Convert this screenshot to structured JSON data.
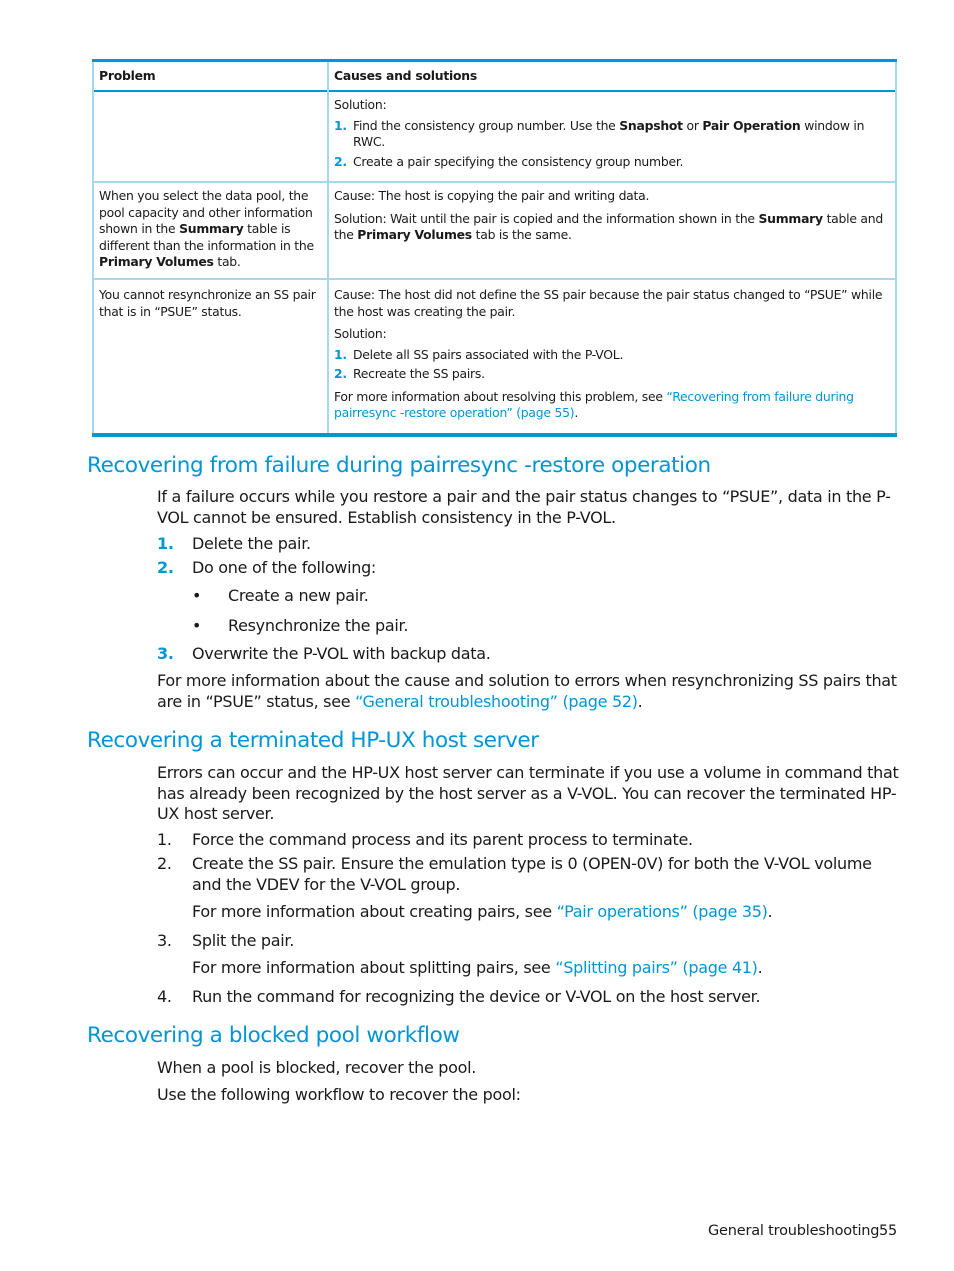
{
  "table": {
    "headers": [
      "Problem",
      "Causes and solutions"
    ],
    "rows": [
      {
        "problem": "",
        "solution_label": "Solution:",
        "steps": [
          {
            "num": "1.",
            "pre": "Find the consistency group number. Use the ",
            "b1": "Snapshot",
            "mid": " or ",
            "b2": "Pair Operation",
            "post": " window in RWC."
          },
          {
            "num": "2.",
            "text": "Create a pair specifying the consistency group number."
          }
        ]
      },
      {
        "problem": {
          "pre": "When you select the data pool, the pool capacity and other information shown in the ",
          "b1": "Summary",
          "mid": " table is different than the information in the ",
          "b2": "Primary Volumes",
          "post": " tab."
        },
        "cause": "Cause: The host is copying the pair and writing data.",
        "solution": {
          "pre": "Solution: Wait until the pair is copied and the information shown in the ",
          "b1": "Summary",
          "mid": " table and the ",
          "b2": "Primary Volumes",
          "post": " tab is the same."
        }
      },
      {
        "problem": "You cannot resynchronize an SS pair that is in “PSUE” status.",
        "cause": "Cause: The host did not define the SS pair because the pair status changed to “PSUE” while the host was creating the pair.",
        "solution_label": "Solution:",
        "steps": [
          {
            "num": "1.",
            "text": "Delete all SS pairs associated with the P-VOL."
          },
          {
            "num": "2.",
            "text": "Recreate the SS pairs."
          }
        ],
        "more_pre": "For more information about resolving this problem, see ",
        "more_link": "“Recovering from failure during pairresync -restore operation” (page 55)",
        "more_post": "."
      }
    ]
  },
  "section1": {
    "title": "Recovering from failure during pairresync -restore operation",
    "intro": "If a failure occurs while you restore a pair and the pair status changes to “PSUE”, data in the P-VOL cannot be ensured. Establish consistency in the P-VOL.",
    "steps": [
      {
        "num": "1.",
        "text": "Delete the pair."
      },
      {
        "num": "2.",
        "text": "Do one of the following:"
      },
      {
        "num": "3.",
        "text": "Overwrite the P-VOL with backup data."
      }
    ],
    "bullets": [
      "Create a new pair.",
      "Resynchronize the pair."
    ],
    "bullet_glyph": "•",
    "more_pre": "For more information about the cause and solution to errors when resynchronizing SS pairs that are in “PSUE” status, see ",
    "more_link": "“General troubleshooting” (page 52)",
    "more_post": "."
  },
  "section2": {
    "title": "Recovering a terminated HP-UX host server",
    "intro": "Errors can occur and the HP-UX host server can terminate if you use a volume in command that has already been recognized by the host server as a V-VOL. You can recover the terminated HP-UX host server.",
    "steps": [
      {
        "num": "1.",
        "text": "Force the command process and its parent process to terminate."
      },
      {
        "num": "2.",
        "text": "Create the SS pair. Ensure the emulation type is 0 (OPEN-0V) for both the V-VOL volume and the VDEV for the V-VOL group."
      },
      {
        "num": "3.",
        "text": "Split the pair."
      },
      {
        "num": "4.",
        "text": "Run the command for recognizing the device or V-VOL on the host server."
      }
    ],
    "note2_pre": "For more information about creating pairs, see ",
    "note2_link": "“Pair operations” (page 35)",
    "note3_pre": "For more information about splitting pairs, see ",
    "note3_link": "“Splitting pairs” (page 41)",
    "period": "."
  },
  "section3": {
    "title": "Recovering a blocked pool workflow",
    "p1": "When a pool is blocked, recover the pool.",
    "p2": "Use the following workflow to recover the pool:"
  },
  "footer": {
    "section": "General troubleshooting",
    "page": "55"
  },
  "colors": {
    "accent": "#0096d6",
    "table_rule_light": "#a8d8ef",
    "text": "#1a1a1a"
  }
}
